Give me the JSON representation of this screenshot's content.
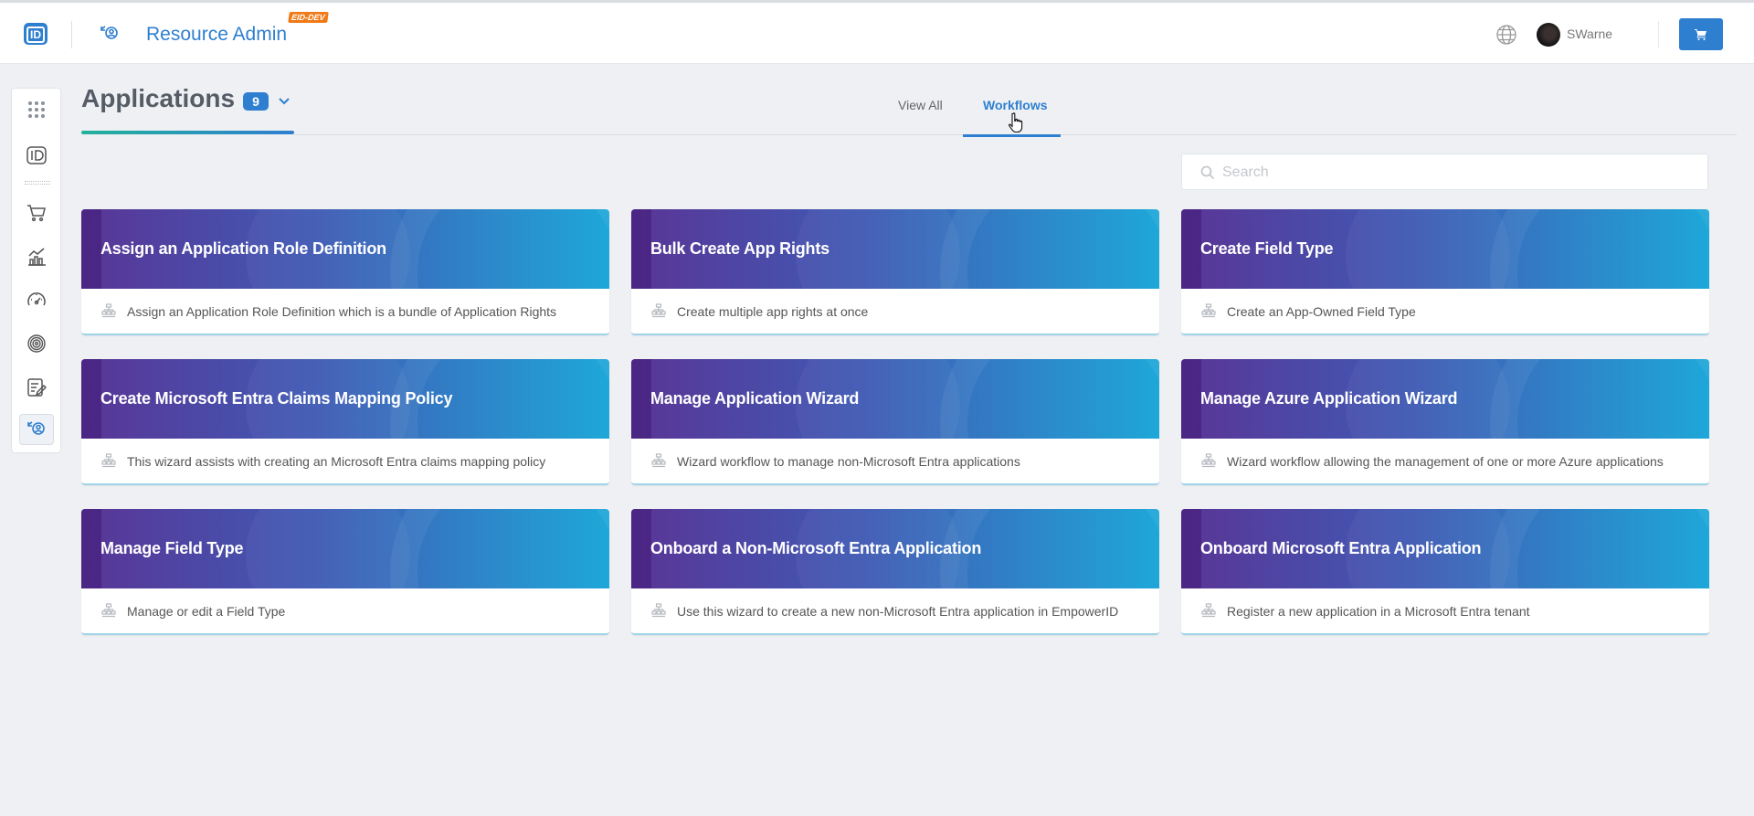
{
  "header": {
    "app_title": "Resource Admin",
    "env_badge": "EID-DEV",
    "user_name": "SWarne",
    "logo_text": "ID"
  },
  "sidenav": {
    "items": [
      {
        "name": "apps-grid-icon"
      },
      {
        "name": "id-icon"
      },
      {
        "name": "cart-icon"
      },
      {
        "name": "chart-icon"
      },
      {
        "name": "gauge-icon"
      },
      {
        "name": "fingerprint-icon"
      },
      {
        "name": "edit-list-icon"
      },
      {
        "name": "resource-admin-icon",
        "active": true
      }
    ]
  },
  "page": {
    "title": "Applications",
    "count": "9"
  },
  "tabs": [
    {
      "label": "View All",
      "active": false
    },
    {
      "label": "Workflows",
      "active": true
    }
  ],
  "search": {
    "placeholder": "Search",
    "value": ""
  },
  "cards": [
    {
      "title": "Assign an Application Role Definition",
      "description": "Assign an Application Role Definition which is a bundle of Application Rights"
    },
    {
      "title": "Bulk Create App Rights",
      "description": "Create multiple app rights at once"
    },
    {
      "title": "Create Field Type",
      "description": "Create an App-Owned Field Type"
    },
    {
      "title": "Create Microsoft Entra Claims Mapping Policy",
      "description": "This wizard assists with creating an Microsoft Entra claims mapping policy"
    },
    {
      "title": "Manage Application Wizard",
      "description": "Wizard workflow to manage non-Microsoft Entra applications"
    },
    {
      "title": "Manage Azure Application Wizard",
      "description": "Wizard workflow allowing the management of one or more Azure applications"
    },
    {
      "title": "Manage Field Type",
      "description": "Manage or edit a Field Type"
    },
    {
      "title": "Onboard a Non-Microsoft Entra Application",
      "description": "Use this wizard to create a new non-Microsoft Entra application in EmpowerID"
    },
    {
      "title": "Onboard Microsoft Entra Application",
      "description": "Register a new application in a Microsoft Entra tenant"
    }
  ],
  "colors": {
    "accent": "#2f7fd0",
    "env_badge": "#f07a17",
    "card_gradient_start": "#5a3596",
    "card_gradient_end": "#1ea7d9"
  }
}
